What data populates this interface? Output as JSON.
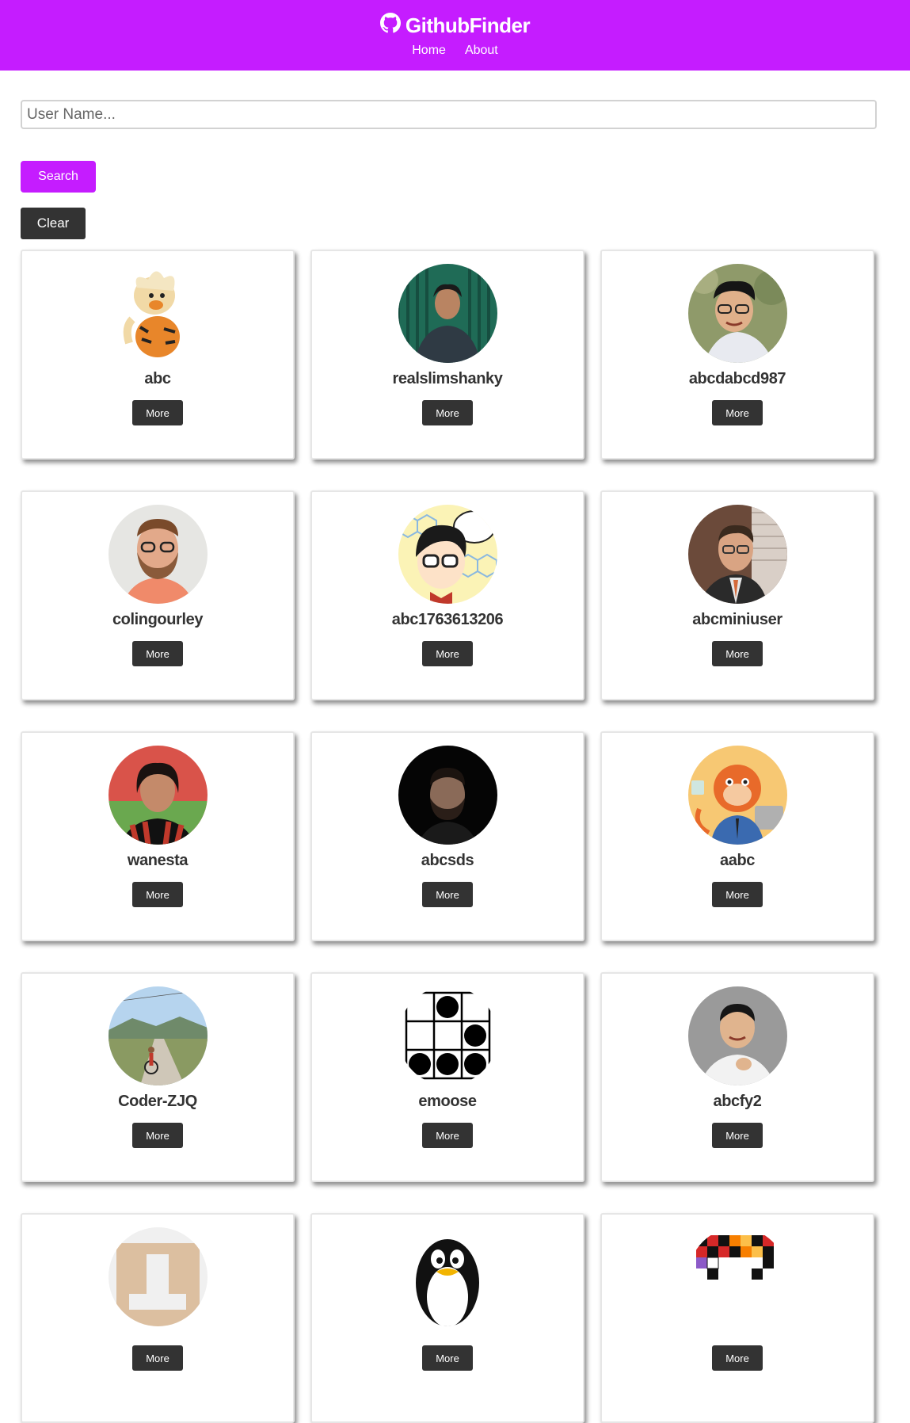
{
  "navbar": {
    "brand_icon": "github-icon",
    "brand": "GithubFinder",
    "links": [
      "Home",
      "About"
    ]
  },
  "search": {
    "placeholder": "User Name...",
    "search_label": "Search",
    "clear_label": "Clear"
  },
  "users": [
    {
      "login": "abc",
      "more_label": "More",
      "avatar": "pokemon-growlithe"
    },
    {
      "login": "realslimshanky",
      "more_label": "More",
      "avatar": "man-green-background"
    },
    {
      "login": "abcdabcd987",
      "more_label": "More",
      "avatar": "man-glasses-outdoors"
    },
    {
      "login": "colingourley",
      "more_label": "More",
      "avatar": "bearded-man-glasses"
    },
    {
      "login": "abc1763613206",
      "more_label": "More",
      "avatar": "cartoon-boy-glasses"
    },
    {
      "login": "abcminiuser",
      "more_label": "More",
      "avatar": "man-suit-glasses"
    },
    {
      "login": "wanesta",
      "more_label": "More",
      "avatar": "footballer-red-black"
    },
    {
      "login": "abcsds",
      "more_label": "More",
      "avatar": "bearded-man-dark"
    },
    {
      "login": "aabc",
      "more_label": "More",
      "avatar": "orange-monkey-cartoon"
    },
    {
      "login": "Coder-ZJQ",
      "more_label": "More",
      "avatar": "cyclist-road"
    },
    {
      "login": "emoose",
      "more_label": "More",
      "avatar": "glider-pattern"
    },
    {
      "login": "abcfy2",
      "more_label": "More",
      "avatar": "man-white-shirt"
    },
    {
      "login": "",
      "more_label": "More",
      "avatar": "identicon-tan"
    },
    {
      "login": "",
      "more_label": "More",
      "avatar": "tux-penguin"
    },
    {
      "login": "",
      "more_label": "More",
      "avatar": "pixel-colorful"
    }
  ],
  "colors": {
    "accent": "#c51cff",
    "dark_button": "#333333"
  }
}
